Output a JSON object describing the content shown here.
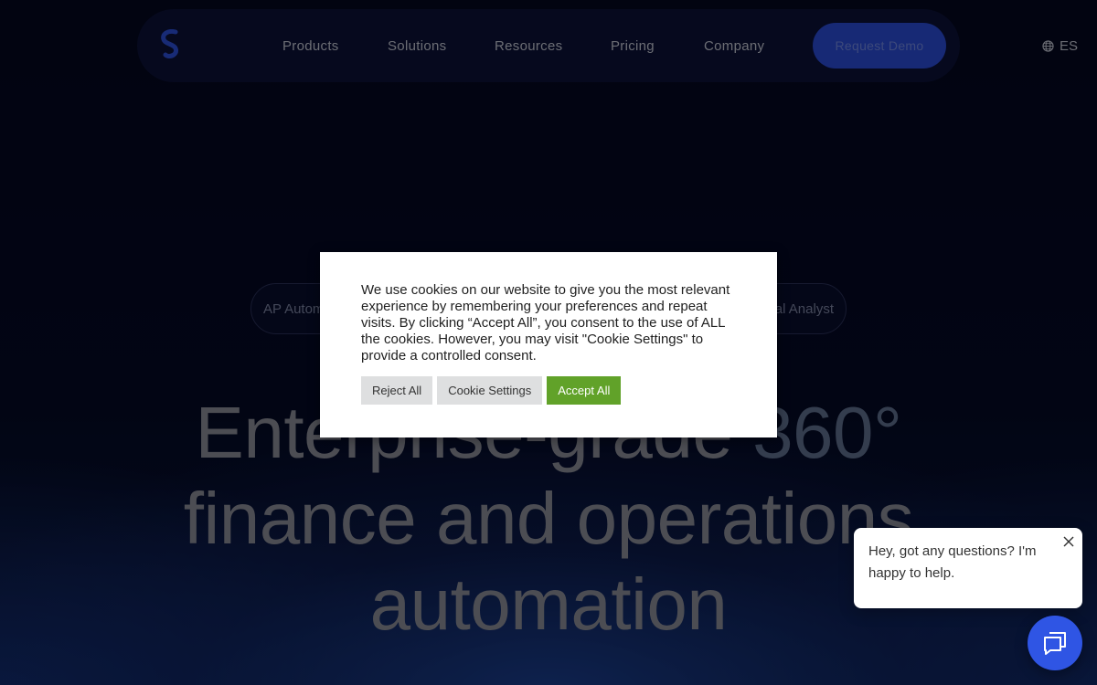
{
  "nav": {
    "items": [
      {
        "label": "Products"
      },
      {
        "label": "Solutions"
      },
      {
        "label": "Resources"
      },
      {
        "label": "Pricing"
      },
      {
        "label": "Company"
      }
    ],
    "cta_label": "Request Demo",
    "language": "ES"
  },
  "pills": {
    "left_label": "AP Autom",
    "right_label": "al Analyst"
  },
  "hero": {
    "line1_a": "Enterprise-grade ",
    "line1_b": "360°",
    "line2": "finance and operations",
    "line3": "automation"
  },
  "cookie": {
    "message": "We use cookies on our website to give you the most relevant experience by remembering your preferences and repeat visits. By clicking “Accept All”, you consent to the use of ALL the cookies. However, you may visit \"Cookie Settings\" to provide a controlled consent.",
    "reject_label": "Reject All",
    "settings_label": "Cookie Settings",
    "accept_label": "Accept All"
  },
  "chat": {
    "message": "Hey, got any questions? I'm happy to help."
  },
  "colors": {
    "background": "#050a24",
    "nav_bg": "#0c1238",
    "cta": "#2a4bd6",
    "accept_green": "#61a229",
    "chat_blue": "#2f55e4"
  },
  "icons": [
    "logo-icon",
    "globe-icon",
    "close-icon",
    "chat-icon"
  ]
}
